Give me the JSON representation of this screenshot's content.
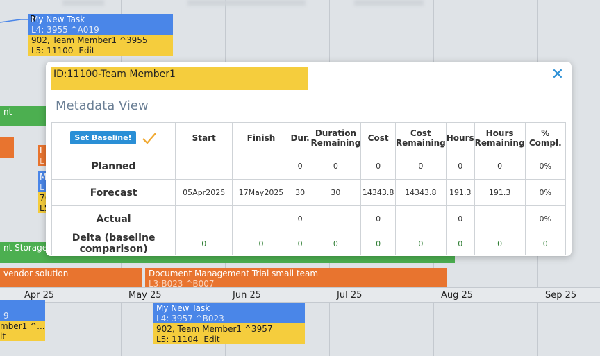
{
  "gantt": {
    "bars": {
      "task1_title": "My New Task",
      "task1_sub": "L4: 3955 ^A019",
      "task1_assign": "902, Team Member1 ^3955",
      "task1_l5": "L5: 11100",
      "task1_edit": "Edit",
      "cursor_text": "R",
      "green_top": "nt",
      "orange_left_l": "L",
      "orange_left_l2": "L",
      "blue_left_m": "M",
      "blue_left_l": "L",
      "yellow_left_7": "7(",
      "yellow_left_l": "L5",
      "storage": "nt Storage",
      "vendor": "vendor solution",
      "docmgmt_title": "Document Management Trial small team",
      "docmgmt_sub": "L3:B023 ^B007",
      "left_blue_9": "9",
      "left_member": "mber1 ^...",
      "left_it": "it",
      "task2_title": "My New Task",
      "task2_sub": "L4: 3957 ^B023",
      "task2_assign": "902, Team Member1 ^3957",
      "task2_l5": "L5: 11104",
      "task2_edit": "Edit"
    },
    "axis": [
      "Apr 25",
      "May 25",
      "Jun 25",
      "Jul 25",
      "Aug 25",
      "Sep 25"
    ]
  },
  "modal": {
    "title": "ID:11100-Team Member1",
    "close_icon": "close-icon",
    "section": "Metadata View",
    "set_baseline_label": "Set Baseline!",
    "headers": [
      "Start",
      "Finish",
      "Dur.",
      "Duration Remaining",
      "Cost",
      "Cost Remaining",
      "Hours",
      "Hours Remaining",
      "% Compl."
    ],
    "rows": [
      {
        "label": "Planned",
        "cells": [
          "",
          "",
          "0",
          "0",
          "0",
          "0",
          "0",
          "0",
          "0%"
        ]
      },
      {
        "label": "Forecast",
        "cells": [
          "05Apr2025",
          "17May2025",
          "30",
          "30",
          "14343.8",
          "14343.8",
          "191.3",
          "191.3",
          "0%"
        ]
      },
      {
        "label": "Actual",
        "cells": [
          "",
          "",
          "0",
          "",
          "0",
          "",
          "0",
          "",
          "0%"
        ]
      },
      {
        "label": "Delta (baseline comparison)",
        "cells": [
          "0",
          "0",
          "0",
          "0",
          "0",
          "0",
          "0",
          "0",
          "0"
        ]
      }
    ],
    "colors": {
      "accent": "#2a8fd6",
      "title_bg": "#f5cd3d",
      "delta_text": "#2e7d32"
    }
  }
}
